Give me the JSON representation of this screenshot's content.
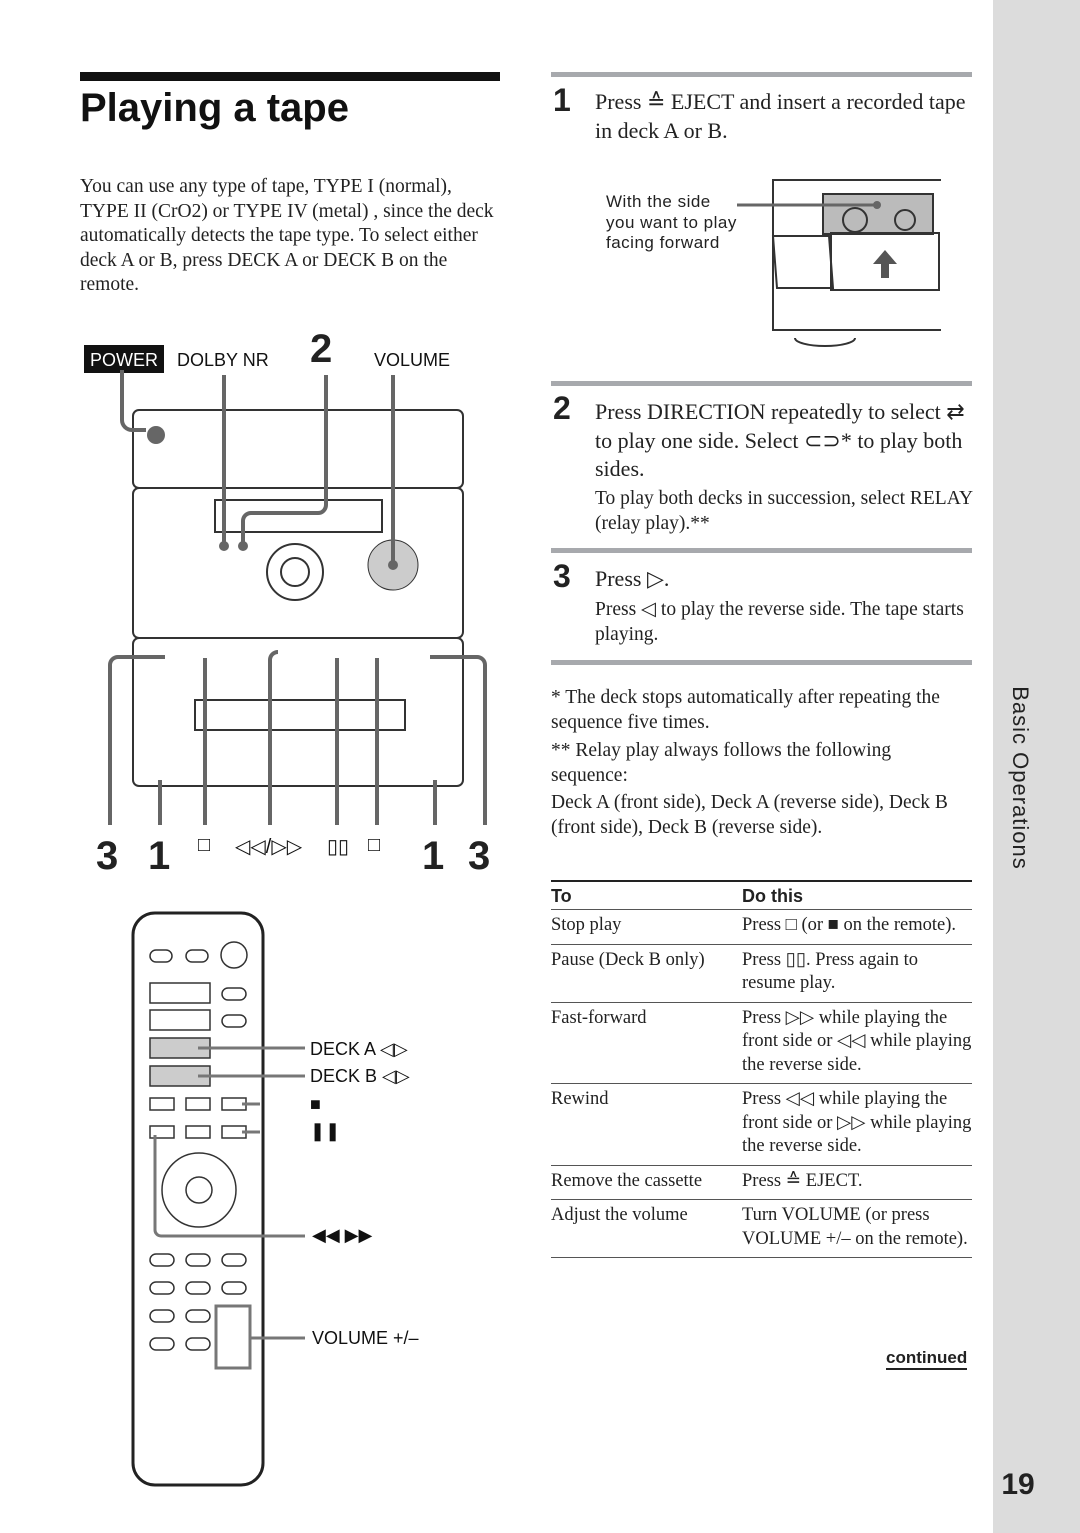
{
  "title": "Playing a tape",
  "intro": "You can use any type of tape, TYPE I (normal), TYPE II (CrO2) or TYPE IV (metal) , since the deck automatically detects the tape type.  To select either deck A or B, press DECK A or DECK B on the remote.",
  "figure_main": {
    "labels": {
      "power": "POWER",
      "dolby": "DOLBY NR",
      "step2": "2",
      "volume": "VOLUME"
    },
    "bottom": {
      "s3l": "3",
      "s1l": "1",
      "stop_l": "□",
      "ffrew": "◁◁/▷▷",
      "pause": "▯▯",
      "stop_r": "□",
      "s1r": "1",
      "s3r": "3"
    }
  },
  "figure_remote": {
    "deck_a": "DECK A ◁▷",
    "deck_b": "DECK B ◁▷",
    "stop": "■",
    "pause": "❚❚",
    "ffrew": "◀◀ ▶▶",
    "volume": "VOLUME +/–"
  },
  "figure_insert": {
    "caption": "With the side you want to play facing forward"
  },
  "steps": [
    {
      "num": "1",
      "text": "Press ≙ EJECT and insert a recorded tape in deck A or B."
    },
    {
      "num": "2",
      "text": "Press DIRECTION repeatedly to select ⇄ to play one side.  Select ⊂⊃* to play both sides.",
      "sub": "To play both decks in succession, select RELAY (relay play).**"
    },
    {
      "num": "3",
      "text": "Press ▷.",
      "sub": "Press ◁ to play the reverse side.  The tape starts playing."
    }
  ],
  "notes": [
    "*  The deck stops automatically after repeating the sequence five times.",
    "** Relay play always follows the following sequence:",
    "Deck A (front side), Deck A (reverse side), Deck B (front side), Deck B (reverse side)."
  ],
  "table": {
    "headers": [
      "To",
      "Do this"
    ],
    "rows": [
      [
        "Stop play",
        "Press □ (or ■ on the remote)."
      ],
      [
        "Pause (Deck B only)",
        "Press ▯▯.  Press again to resume play."
      ],
      [
        "Fast-forward",
        "Press ▷▷ while playing the front side or ◁◁ while playing the reverse side."
      ],
      [
        "Rewind",
        "Press ◁◁ while playing the front side or ▷▷ while playing the reverse side."
      ],
      [
        "Remove the cassette",
        "Press ≙ EJECT."
      ],
      [
        "Adjust the volume",
        "Turn VOLUME (or press VOLUME +/– on the remote)."
      ]
    ]
  },
  "continued": "continued",
  "section": "Basic Operations",
  "page_number": "19"
}
